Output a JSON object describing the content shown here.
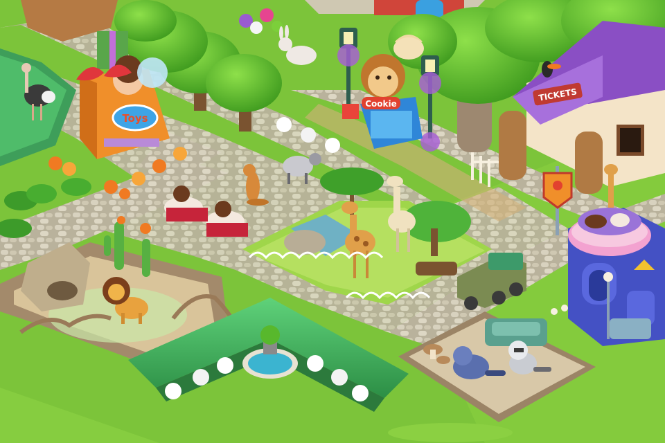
{
  "scene": {
    "title": "",
    "colors": {
      "grass": "#7cc43a",
      "grass_light": "#a6dc4a",
      "path_stone": "#c9c2ae",
      "dirt": "#d9c49a",
      "hedge": "#3fae5a",
      "tree": "#58b82c",
      "purple_roof": "#8a4fc4"
    }
  },
  "buildings": {
    "toy_shop": {
      "sign": "Toys",
      "icon": "gift-box-icon"
    },
    "cookie_shop": {
      "sign": "Cookie",
      "icon": "monkey-icon"
    },
    "ticket_booth": {
      "sign": "TICKETS",
      "icon": "toucan-icon"
    },
    "hotel": {
      "icon": "castle-icon"
    }
  },
  "enclosures": {
    "lion": {
      "animal": "lion-icon"
    },
    "giraffe": {
      "animal": "giraffe-icon"
    },
    "raccoon": {
      "animal": "raccoon-icon"
    },
    "ostrich": {
      "animal": "ostrich-icon"
    }
  },
  "wandering_animals": [
    "rabbit-icon",
    "meerkat-icon",
    "badger-icon",
    "sheep-icon"
  ]
}
